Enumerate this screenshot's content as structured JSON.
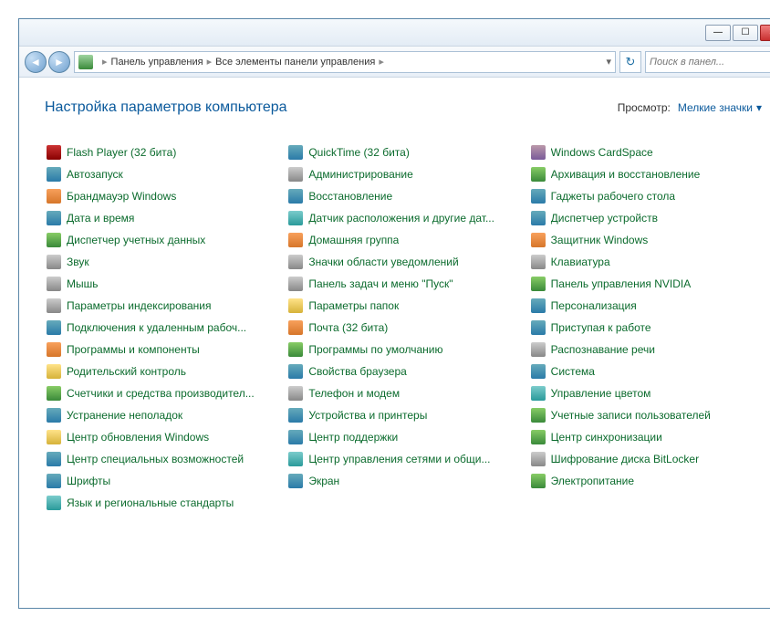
{
  "window": {
    "minimize_tip": "Свернуть",
    "maximize_tip": "Развернуть",
    "close_tip": "Закрыть"
  },
  "breadcrumb": {
    "part1": "Панель управления",
    "part2": "Все элементы панели управления"
  },
  "search": {
    "placeholder": "Поиск в панел..."
  },
  "heading": "Настройка параметров компьютера",
  "view": {
    "label": "Просмотр:",
    "value": "Мелкие значки"
  },
  "columns": [
    [
      {
        "label": "Flash Player (32 бита)",
        "icon": "red",
        "highlight": false
      },
      {
        "label": "Автозапуск",
        "icon": "blue",
        "highlight": false
      },
      {
        "label": "Брандмауэр Windows",
        "icon": "orange",
        "highlight": false
      },
      {
        "label": "Дата и время",
        "icon": "blue",
        "highlight": false
      },
      {
        "label": "Диспетчер учетных данных",
        "icon": "green",
        "highlight": false
      },
      {
        "label": "Звук",
        "icon": "grey",
        "highlight": false
      },
      {
        "label": "Мышь",
        "icon": "grey",
        "highlight": false
      },
      {
        "label": "Параметры индексирования",
        "icon": "grey",
        "highlight": false
      },
      {
        "label": "Подключения к удаленным рабоч...",
        "icon": "blue",
        "highlight": false
      },
      {
        "label": "Программы и компоненты",
        "icon": "orange",
        "highlight": true
      },
      {
        "label": "Родительский контроль",
        "icon": "yellow",
        "highlight": false
      },
      {
        "label": "Счетчики и средства производител...",
        "icon": "green",
        "highlight": false
      },
      {
        "label": "Устранение неполадок",
        "icon": "blue",
        "highlight": false
      },
      {
        "label": "Центр обновления Windows",
        "icon": "yellow",
        "highlight": false
      },
      {
        "label": "Центр специальных возможностей",
        "icon": "blue",
        "highlight": false
      },
      {
        "label": "Шрифты",
        "icon": "blue",
        "highlight": false
      },
      {
        "label": "Язык и региональные стандарты",
        "icon": "teal",
        "highlight": false
      }
    ],
    [
      {
        "label": "QuickTime (32 бита)",
        "icon": "blue",
        "highlight": false
      },
      {
        "label": "Администрирование",
        "icon": "grey",
        "highlight": false
      },
      {
        "label": "Восстановление",
        "icon": "blue",
        "highlight": false
      },
      {
        "label": "Датчик расположения и другие дат...",
        "icon": "teal",
        "highlight": false
      },
      {
        "label": "Домашняя группа",
        "icon": "orange",
        "highlight": false
      },
      {
        "label": "Значки области уведомлений",
        "icon": "grey",
        "highlight": false
      },
      {
        "label": "Панель задач и меню \"Пуск\"",
        "icon": "grey",
        "highlight": false
      },
      {
        "label": "Параметры папок",
        "icon": "yellow",
        "highlight": false
      },
      {
        "label": "Почта (32 бита)",
        "icon": "orange",
        "highlight": false
      },
      {
        "label": "Программы по умолчанию",
        "icon": "green",
        "highlight": false
      },
      {
        "label": "Свойства браузера",
        "icon": "blue",
        "highlight": false
      },
      {
        "label": "Телефон и модем",
        "icon": "grey",
        "highlight": false
      },
      {
        "label": "Устройства и принтеры",
        "icon": "blue",
        "highlight": false
      },
      {
        "label": "Центр поддержки",
        "icon": "blue",
        "highlight": false
      },
      {
        "label": "Центр управления сетями и общи...",
        "icon": "teal",
        "highlight": false
      },
      {
        "label": "Экран",
        "icon": "blue",
        "highlight": false
      }
    ],
    [
      {
        "label": "Windows CardSpace",
        "icon": "purple",
        "highlight": false
      },
      {
        "label": "Архивация и восстановление",
        "icon": "green",
        "highlight": false
      },
      {
        "label": "Гаджеты рабочего стола",
        "icon": "blue",
        "highlight": false
      },
      {
        "label": "Диспетчер устройств",
        "icon": "blue",
        "highlight": false
      },
      {
        "label": "Защитник Windows",
        "icon": "orange",
        "highlight": false
      },
      {
        "label": "Клавиатура",
        "icon": "grey",
        "highlight": false
      },
      {
        "label": "Панель управления NVIDIA",
        "icon": "green",
        "highlight": false
      },
      {
        "label": "Персонализация",
        "icon": "blue",
        "highlight": false
      },
      {
        "label": "Приступая к работе",
        "icon": "blue",
        "highlight": false
      },
      {
        "label": "Распознавание речи",
        "icon": "grey",
        "highlight": false
      },
      {
        "label": "Система",
        "icon": "blue",
        "highlight": false
      },
      {
        "label": "Управление цветом",
        "icon": "teal",
        "highlight": false
      },
      {
        "label": "Учетные записи пользователей",
        "icon": "green",
        "highlight": false
      },
      {
        "label": "Центр синхронизации",
        "icon": "green",
        "highlight": false
      },
      {
        "label": "Шифрование диска BitLocker",
        "icon": "grey",
        "highlight": false
      },
      {
        "label": "Электропитание",
        "icon": "green",
        "highlight": false
      }
    ]
  ]
}
